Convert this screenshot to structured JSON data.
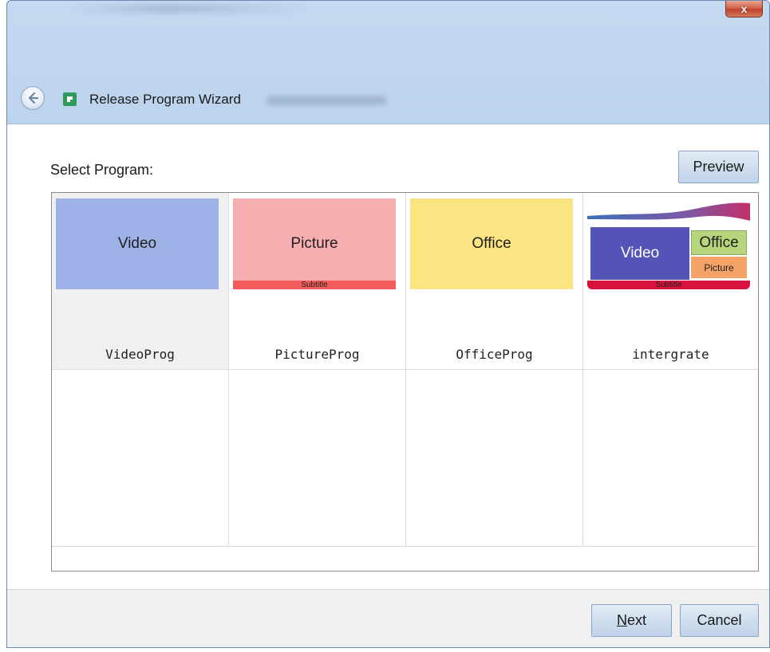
{
  "window": {
    "title": "Release Program Wizard",
    "close_symbol": "x"
  },
  "content": {
    "select_label": "Select Program:",
    "preview_label": "Preview"
  },
  "programs": [
    {
      "name": "VideoProg",
      "thumb_label": "Video",
      "thumb_color": "#9fb2e8",
      "selected": true
    },
    {
      "name": "PictureProg",
      "thumb_label": "Picture",
      "thumb_color": "#f6aeb0",
      "subtitle": "Subtitle"
    },
    {
      "name": "OfficeProg",
      "thumb_label": "Office",
      "thumb_color": "#fde483"
    },
    {
      "name": "intergrate",
      "video_label": "Video",
      "office_label": "Office",
      "picture_label": "Picture",
      "subtitle": "Subtitle"
    }
  ],
  "footer": {
    "next_label": "Next",
    "next_mnemonic": "N",
    "next_rest": "ext",
    "cancel_label": "Cancel"
  },
  "colors": {
    "titlebar": "#c5d9f1",
    "button_bg": "#cfdeee",
    "selected_cell": "#f0f0f0",
    "subtitle_red": "#f25c5c",
    "integrated_subtitle": "#d7123f",
    "integrated_video": "#5454b8",
    "integrated_office": "#b7d57b",
    "integrated_picture": "#f5a267"
  }
}
